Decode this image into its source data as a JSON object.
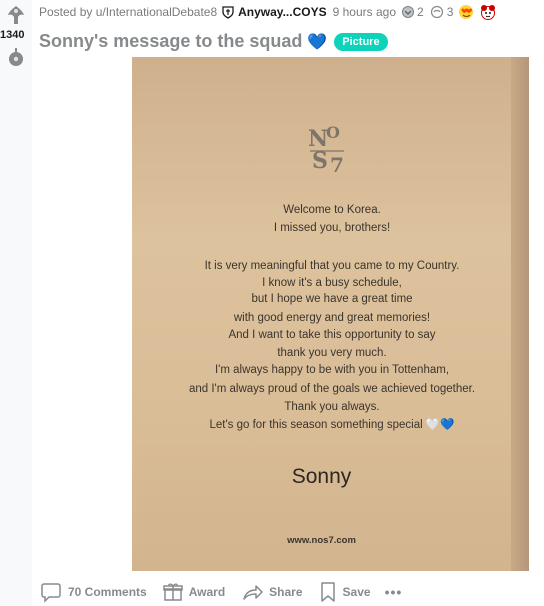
{
  "vote": {
    "score": "1340"
  },
  "post": {
    "posted_by": "Posted by u/InternationalDebate8",
    "flair": "Anyway...COYS",
    "time": "9 hours ago",
    "awards": [
      {
        "icon": "silver-award-icon",
        "count": "2"
      },
      {
        "icon": "helpful-award-icon",
        "count": "3"
      },
      {
        "icon": "heart-eyes-award-icon",
        "count": ""
      },
      {
        "icon": "wholesome-award-icon",
        "count": ""
      }
    ],
    "title": "Sonny's message to the squad",
    "title_emoji": "💙",
    "tag": "Picture"
  },
  "letter": {
    "logo_text": "NOS7",
    "greeting_lines": [
      "Welcome to Korea.",
      "I missed you, brothers!"
    ],
    "body_lines": [
      "It is very meaningful that you came to my Country.",
      "I know it's a busy schedule,",
      "but I hope we have a great time",
      "with good energy and great memories!",
      "And I want to take this opportunity to say",
      "thank you very much.",
      "I'm always happy to be with you in Tottenham,",
      "and I'm always proud of the goals we achieved together.",
      "Thank you always.",
      "Let's go for this season something special 🤍💙"
    ],
    "signature": "Sonny",
    "website": "www.nos7.com"
  },
  "actions": {
    "comments": "70 Comments",
    "award": "Award",
    "share": "Share",
    "save": "Save",
    "more": "•••"
  },
  "colors": {
    "tag_bg": "#0dd3bb",
    "card": "#dcbf99",
    "muted": "#878a8c"
  }
}
